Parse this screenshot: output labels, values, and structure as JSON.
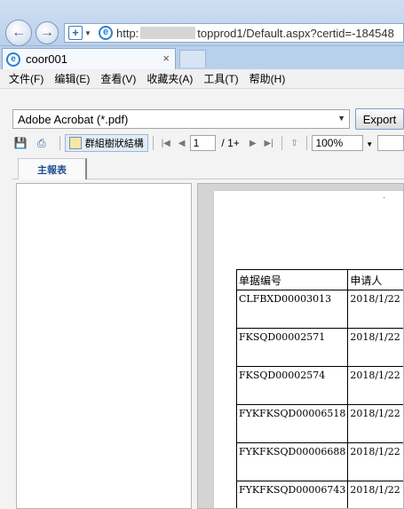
{
  "browser": {
    "url_prefix": "http:",
    "url_suffix": "topprod1/Default.aspx?certid=-184548",
    "tab_title": "coor001",
    "tab_close": "×"
  },
  "menu": [
    {
      "label": "文件(F)"
    },
    {
      "label": "编辑(E)"
    },
    {
      "label": "查看(V)"
    },
    {
      "label": "收藏夹(A)"
    },
    {
      "label": "工具(T)"
    },
    {
      "label": "帮助(H)"
    }
  ],
  "viewer": {
    "format": "Adobe Acrobat (*.pdf)",
    "export_label": "Export",
    "group_tree_label": "群組樹狀結構",
    "page_current": "1",
    "page_total": "/ 1+",
    "zoom": "100%",
    "report_tab": "主報表"
  },
  "table": {
    "headers": [
      "单据编号",
      "申请人"
    ],
    "rows": [
      [
        "CLFBXD00003013",
        "2018/1/22"
      ],
      [
        "FKSQD00002571",
        "2018/1/22"
      ],
      [
        "FKSQD00002574",
        "2018/1/22"
      ],
      [
        "FYKFKSQD00006518",
        "2018/1/22"
      ],
      [
        "FYKFKSQD00006688",
        "2018/1/22"
      ],
      [
        "FYKFKSQD00006743",
        "2018/1/22"
      ]
    ]
  }
}
